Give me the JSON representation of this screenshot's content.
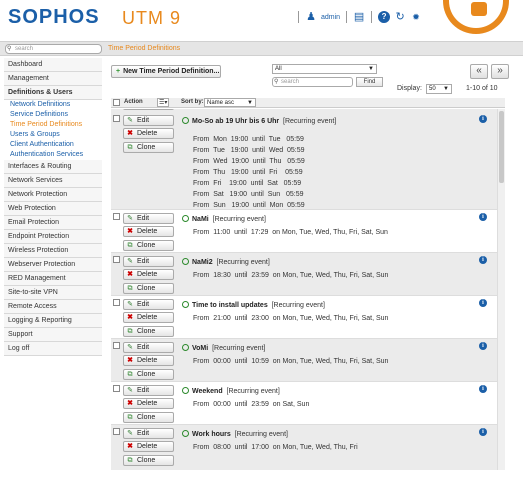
{
  "app": {
    "brand": "SOPHOS",
    "product": "UTM 9",
    "user": "admin"
  },
  "search": {
    "placeholder": "search"
  },
  "breadcrumb": "Time Period Definitions",
  "sidebar": [
    {
      "label": "Dashboard",
      "type": "item"
    },
    {
      "label": "Management",
      "type": "item"
    },
    {
      "label": "Definitions & Users",
      "type": "bold"
    },
    {
      "label": "Network Definitions",
      "type": "sub"
    },
    {
      "label": "Service Definitions",
      "type": "sub"
    },
    {
      "label": "Time Period Definitions",
      "type": "active"
    },
    {
      "label": "Users & Groups",
      "type": "sub"
    },
    {
      "label": "Client Authentication",
      "type": "sub"
    },
    {
      "label": "Authentication Services",
      "type": "sub"
    },
    {
      "label": "Interfaces & Routing",
      "type": "item"
    },
    {
      "label": "Network Services",
      "type": "item"
    },
    {
      "label": "Network Protection",
      "type": "item"
    },
    {
      "label": "Web Protection",
      "type": "item"
    },
    {
      "label": "Email Protection",
      "type": "item"
    },
    {
      "label": "Endpoint Protection",
      "type": "item"
    },
    {
      "label": "Wireless Protection",
      "type": "item"
    },
    {
      "label": "Webserver Protection",
      "type": "item"
    },
    {
      "label": "RED Management",
      "type": "item"
    },
    {
      "label": "Site-to-site VPN",
      "type": "item"
    },
    {
      "label": "Remote Access",
      "type": "item"
    },
    {
      "label": "Logging & Reporting",
      "type": "item"
    },
    {
      "label": "Support",
      "type": "item"
    },
    {
      "label": "Log off",
      "type": "item"
    }
  ],
  "toolbar": {
    "new_button": "New Time Period Definition...",
    "filter_value": "All",
    "search_placeholder": "search",
    "find_button": "Find",
    "prev": "«",
    "next": "»",
    "display_label": "Display:",
    "display_value": "50",
    "count": "1-10 of 10"
  },
  "list_header": {
    "action": "Action",
    "sort_label": "Sort by:",
    "sort_value": "Name asc"
  },
  "actions": {
    "edit": "Edit",
    "delete": "Delete",
    "clone": "Clone"
  },
  "entries": [
    {
      "name": "Mo-So ab 19 Uhr bis 6 Uhr",
      "kind": "[Recurring event]",
      "times": [
        "From  Mon  19:00  until  Tue   05:59",
        "From  Tue   19:00  until  Wed  05:59",
        "From  Wed  19:00  until  Thu   05:59",
        "From  Thu   19:00  until  Fri    05:59",
        "From  Fri    19:00  until  Sat   05:59",
        "From  Sat   19:00  until  Sun   05:59",
        "From  Sun   19:00  until  Mon  05:59"
      ]
    },
    {
      "name": "NaMi",
      "kind": "[Recurring event]",
      "times": [
        "From  11:00  until  17:29  on Mon, Tue, Wed, Thu, Fri, Sat, Sun"
      ]
    },
    {
      "name": "NaMi2",
      "kind": "[Recurring event]",
      "times": [
        "From  18:30  until  23:59  on Mon, Tue, Wed, Thu, Fri, Sat, Sun"
      ]
    },
    {
      "name": "Time to install updates",
      "kind": "[Recurring event]",
      "times": [
        "From  21:00  until  23:00  on Mon, Tue, Wed, Thu, Fri, Sat, Sun"
      ]
    },
    {
      "name": "VoMi",
      "kind": "[Recurring event]",
      "times": [
        "From  00:00  until  10:59  on Mon, Tue, Wed, Thu, Fri, Sat, Sun"
      ]
    },
    {
      "name": "Weekend",
      "kind": "[Recurring event]",
      "times": [
        "From  00:00  until  23:59  on Sat, Sun"
      ]
    },
    {
      "name": "Work hours",
      "kind": "[Recurring event]",
      "times": [
        "From  08:00  until  17:00  on Mon, Tue, Wed, Thu, Fri"
      ]
    }
  ]
}
